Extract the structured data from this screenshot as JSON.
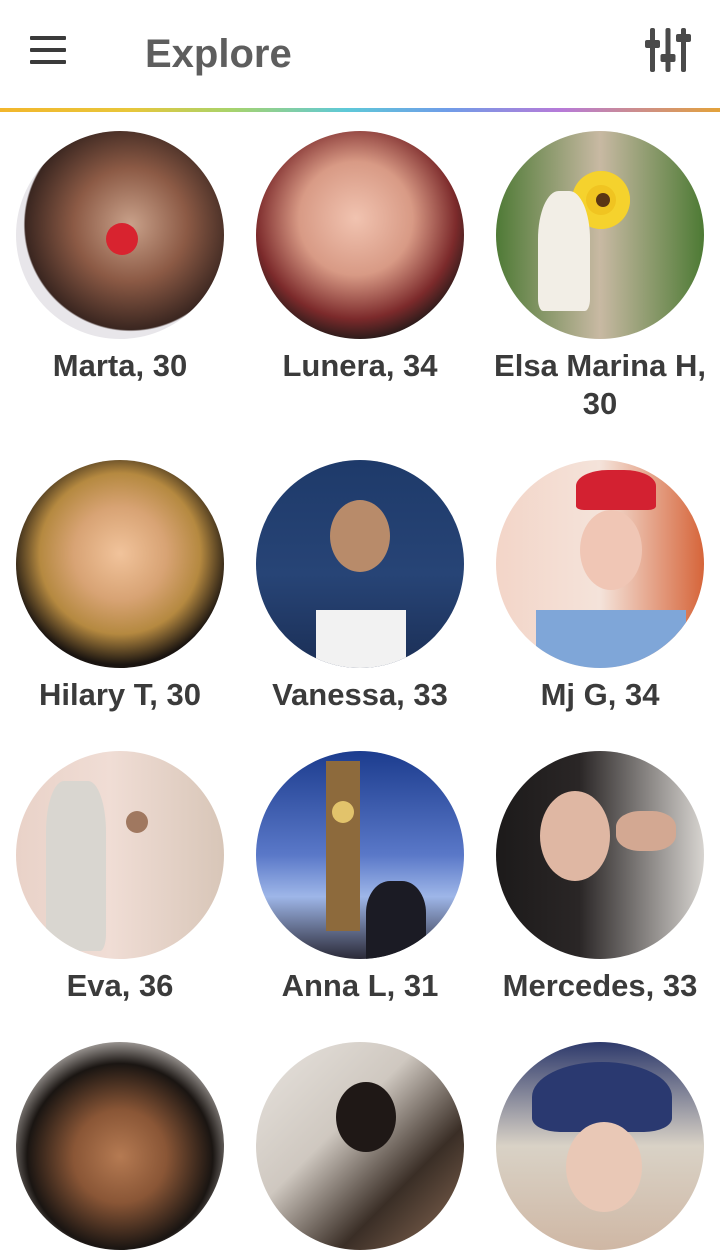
{
  "header": {
    "menu_icon": "hamburger-menu-icon",
    "title": "Explore",
    "filter_icon": "sliders-icon"
  },
  "profiles": [
    {
      "label": "Marta, 30"
    },
    {
      "label": "Lunera, 34"
    },
    {
      "label": "Elsa Marina H, 30"
    },
    {
      "label": "Hilary T, 30"
    },
    {
      "label": "Vanessa, 33"
    },
    {
      "label": "Mj G, 34"
    },
    {
      "label": "Eva, 36"
    },
    {
      "label": "Anna L, 31"
    },
    {
      "label": "Mercedes, 33"
    },
    {
      "label": ""
    },
    {
      "label": ""
    },
    {
      "label": ""
    }
  ],
  "colors": {
    "title": "#5e5e5e",
    "name_text": "#3b3b3b",
    "background": "#ffffff"
  }
}
